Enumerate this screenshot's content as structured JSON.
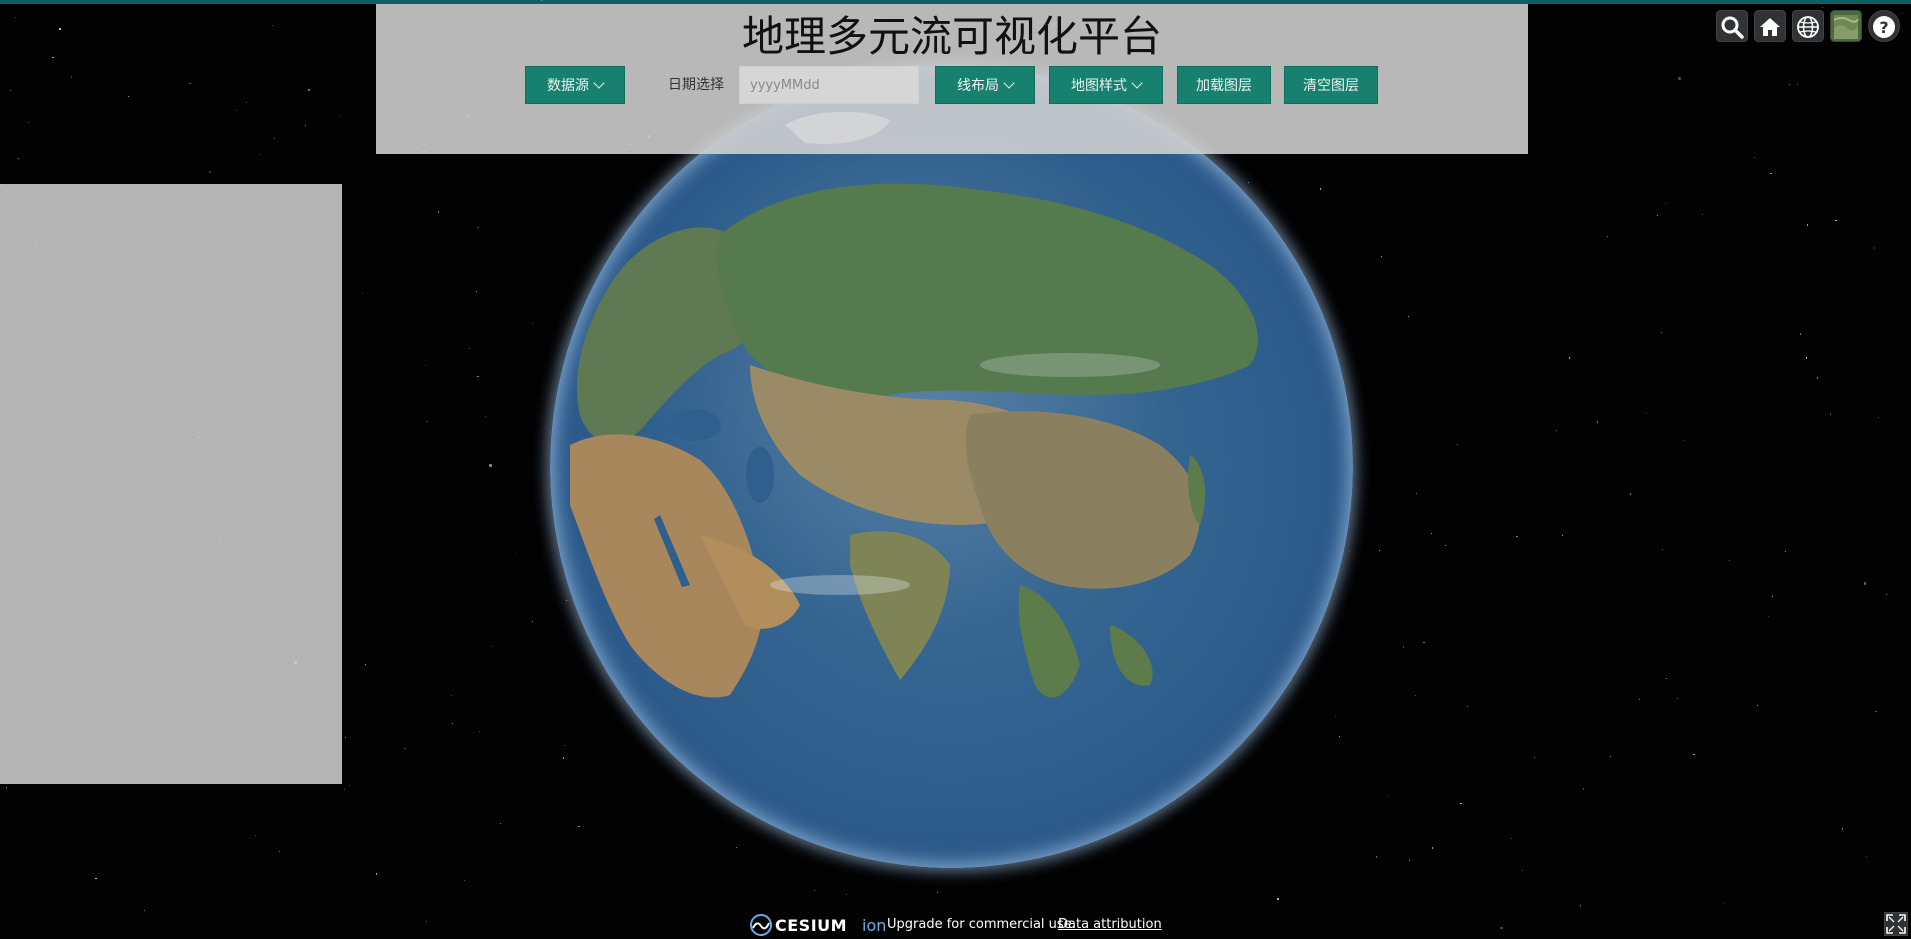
{
  "header": {
    "title": "地理多元流可视化平台",
    "data_source_label": "数据源",
    "date_label": "日期选择",
    "date_placeholder": "yyyyMMdd",
    "date_value": "",
    "line_layout_label": "线布局",
    "map_style_label": "地图样式",
    "load_layer_label": "加载图层",
    "clear_layer_label": "清空图层"
  },
  "toolbar": {
    "icons": [
      "search-icon",
      "home-icon",
      "globe-icon",
      "imagery-layer-icon",
      "help-icon"
    ]
  },
  "credits": {
    "logo_text": "CESIUM",
    "logo_suffix": "ion",
    "message": "Upgrade for commercial use.",
    "link": "Data attribution"
  },
  "colors": {
    "button": "#17806e",
    "header_panel": "#d2d2d2",
    "ocean": "#2f5f8d",
    "accent_ion": "#6dabe4"
  }
}
